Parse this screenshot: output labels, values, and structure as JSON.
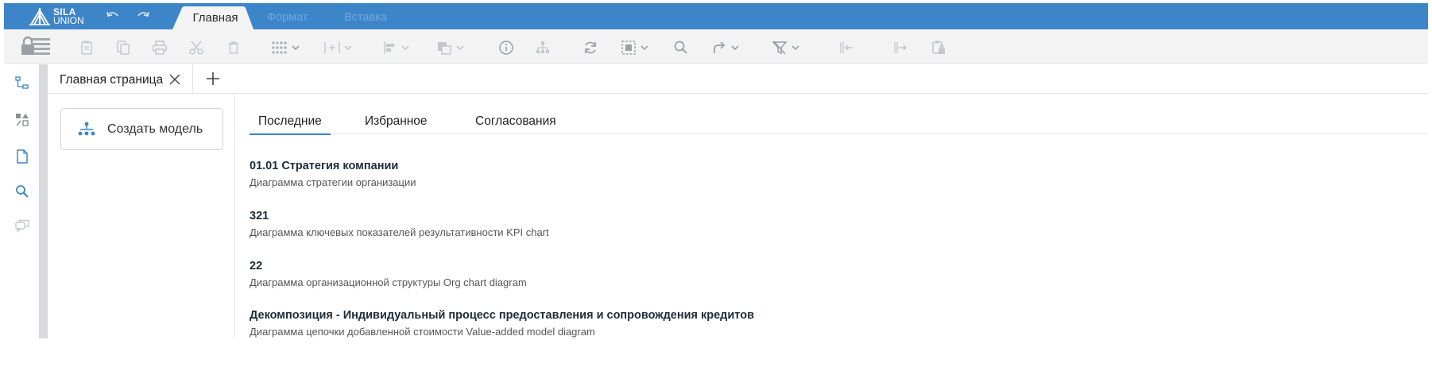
{
  "app": {
    "logo_line1": "SILA",
    "logo_line2": "UNION"
  },
  "ribbon_tabs": {
    "main": "Главная",
    "format": "Формат",
    "insert": "Вставка"
  },
  "colors": {
    "brand_blue": "#3d85c9",
    "toolbar_bg": "#f3f3f3",
    "icon_disabled": "#c4c8cc",
    "icon_active": "#9aa0a6",
    "accent_blue": "#3d85c9"
  },
  "toolbar_icons": [
    "lock-layers-icon",
    "clipboard-icon",
    "copy-icon",
    "print-icon",
    "cut-icon",
    "delete-icon",
    "grid-dots-icon",
    "insert-column-icon",
    "align-left-icon",
    "arrange-icon",
    "info-icon",
    "hierarchy-icon",
    "refresh-icon",
    "select-icon",
    "search-icon",
    "redirect-icon",
    "filter-clear-icon",
    "collapse-left-icon",
    "expand-right-icon",
    "clipboard-lock-icon"
  ],
  "sidebar_icons": [
    "tree-icon",
    "shapes-icon",
    "document-icon",
    "search-icon",
    "chat-icon"
  ],
  "document_tab": {
    "label": "Главная страница"
  },
  "left_panel": {
    "create_model_label": "Создать модель"
  },
  "content_tabs": {
    "recent": "Последние",
    "favorites": "Избранное",
    "approvals": "Согласования"
  },
  "recent_items": [
    {
      "title": "01.01 Стратегия компании",
      "desc": "Диаграмма стратегии организации"
    },
    {
      "title": "321",
      "desc": "Диаграмма ключевых показателей результативности KPI chart"
    },
    {
      "title": "22",
      "desc": "Диаграмма организационной структуры Org chart diagram"
    },
    {
      "title": "Декомпозиция - Индивидуальный процесс предоставления и сопровождения кредитов",
      "desc": "Диаграмма цепочки добавленной стоимости Value-added model diagram"
    }
  ]
}
